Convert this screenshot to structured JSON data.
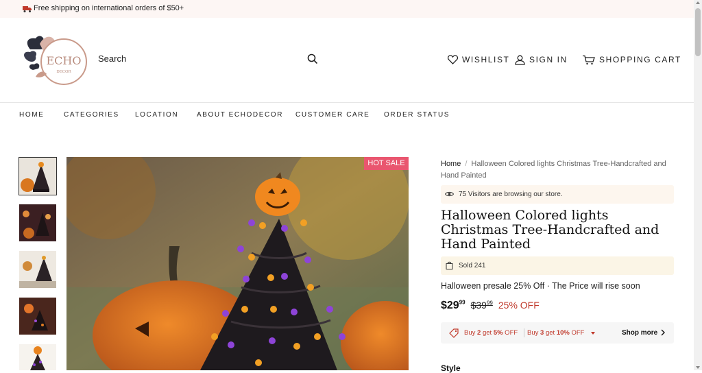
{
  "announcement": {
    "text": "Free shipping on international orders of $50+"
  },
  "logo": {
    "text": "ECHO",
    "subtext": "DECOR"
  },
  "search": {
    "label": "Search"
  },
  "header_links": {
    "wishlist": "WISHLIST",
    "sign_in": "SIGN IN",
    "cart": "SHOPPING CART"
  },
  "nav": [
    "HOME",
    "CATEGORIES",
    "LOCATION",
    "ABOUT ECHODECOR",
    "CUSTOMER CARE",
    "ORDER STATUS"
  ],
  "product": {
    "badge": "HOT SALE",
    "breadcrumb_home": "Home",
    "breadcrumb_sep": "/",
    "breadcrumb_current": "Halloween Colored lights Christmas Tree-Handcrafted and Hand Painted",
    "visitors": "75 Visitors are browsing our store.",
    "title": "Halloween Colored lights Christmas Tree-Handcrafted and Hand Painted",
    "sold": "Sold 241",
    "presale": "Halloween presale 25% Off · The Price will rise soon",
    "price_main": "$29",
    "price_cents": "99",
    "price_old": "$39",
    "price_old_cents": "99",
    "discount": "25% OFF",
    "offer1_a": "Buy ",
    "offer1_n": "2",
    "offer1_b": " get ",
    "offer1_pct": "5%",
    "offer1_c": " OFF",
    "offer2_a": "Buy ",
    "offer2_n": "3",
    "offer2_b": " get ",
    "offer2_pct": "10%",
    "offer2_c": " OFF",
    "shop_more": "Shop more",
    "style_label": "Style"
  },
  "colors": {
    "accent": "#e9566f",
    "sale_red": "#c0392b",
    "announce_bg": "#fdf6f4"
  }
}
